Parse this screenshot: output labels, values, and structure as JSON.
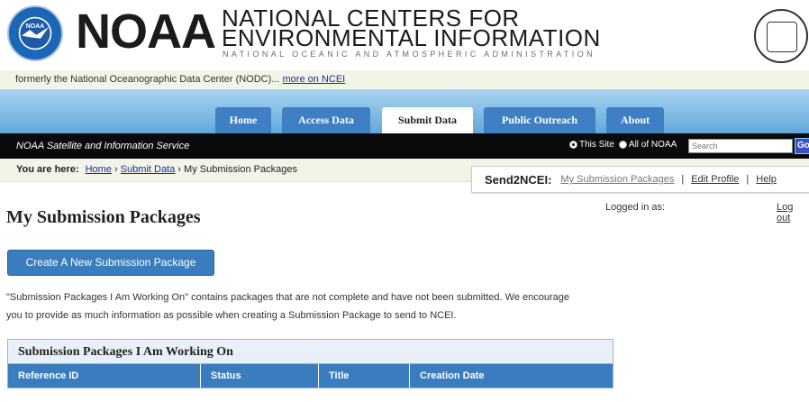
{
  "header": {
    "noaa_wordmark": "NOAA",
    "ncei_line1": "NATIONAL CENTERS FOR",
    "ncei_line2": "ENVIRONMENTAL INFORMATION",
    "ncei_sub": "NATIONAL OCEANIC AND ATMOSPHERIC ADMINISTRATION",
    "noaa_seal_text": "NOAA"
  },
  "formerly": {
    "text": "formerly the National Oceanographic Data Center (NODC)...",
    "link": "more on NCEI"
  },
  "nav": {
    "tabs": [
      {
        "label": "Home",
        "active": false
      },
      {
        "label": "Access Data",
        "active": false
      },
      {
        "label": "Submit Data",
        "active": true
      },
      {
        "label": "Public Outreach",
        "active": false
      },
      {
        "label": "About",
        "active": false
      }
    ]
  },
  "blackbar": {
    "nesdis": "NOAA Satellite and Information Service",
    "radio_this_site": "This Site",
    "radio_all_noaa": "All of NOAA",
    "search_placeholder": "Search",
    "go_label": "Go"
  },
  "breadcrumb": {
    "label": "You are here:",
    "home": "Home",
    "submit_data": "Submit Data",
    "current": "My Submission Packages"
  },
  "send2": {
    "brand": "Send2NCEI:",
    "link1": "My Submission Packages",
    "link2": "Edit Profile",
    "link3": "Help"
  },
  "account": {
    "logged_in_as": "Logged in as:",
    "logout": "Log out"
  },
  "main": {
    "title": "My Submission Packages",
    "create_button": "Create A New Submission Package",
    "description_line1": "\"Submission Packages I Am Working On\" contains packages that are not complete and have not been submitted. We encourage",
    "description_line2": "you to provide as much information as possible when creating a Submission Package to send to NCEI."
  },
  "table": {
    "caption": "Submission Packages I Am Working On",
    "columns": [
      "Reference ID",
      "Status",
      "Title",
      "Creation Date"
    ]
  },
  "colors": {
    "nav_gradient_top": "#a9d4f0",
    "tab_blue": "#3f7fc4",
    "button_blue": "#3a7dbf",
    "link_blue": "#1a2ca0"
  }
}
